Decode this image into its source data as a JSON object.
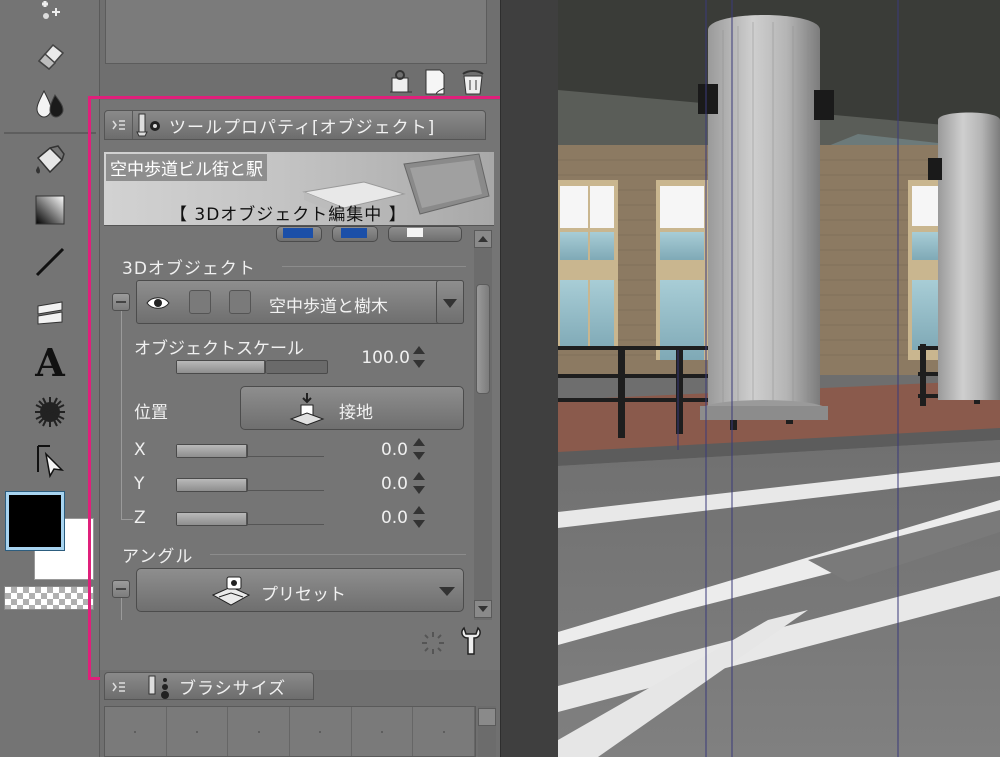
{
  "tool_property": {
    "tab_title": "ツールプロパティ[オブジェクト]",
    "preview_title": "空中歩道ビル街と駅",
    "preview_status": "【 3Dオブジェクト編集中 】",
    "section_3d": "3Dオブジェクト",
    "object_name": "空中歩道と樹木",
    "scale_label": "オブジェクトスケール",
    "scale_value": "100.0",
    "position_label": "位置",
    "ground_button": "接地",
    "x_label": "X",
    "x_value": "0.0",
    "y_label": "Y",
    "y_value": "0.0",
    "z_label": "Z",
    "z_value": "0.0",
    "section_angle": "アングル",
    "preset_button": "プリセット"
  },
  "brush_size": {
    "tab_title": "ブラシサイズ"
  },
  "colors": {
    "main_color": "#000000",
    "sub_color": "#ffffff",
    "highlight": "#e0207b"
  },
  "icons": [
    "add-tool-icon",
    "eraser-icon",
    "blend-icon",
    "fill-icon",
    "gradient-icon",
    "line-icon",
    "figure-icon",
    "text-icon",
    "decoration-icon",
    "operation-icon",
    "eye-icon",
    "ground-icon",
    "preset-camera-icon",
    "wrench-icon"
  ]
}
